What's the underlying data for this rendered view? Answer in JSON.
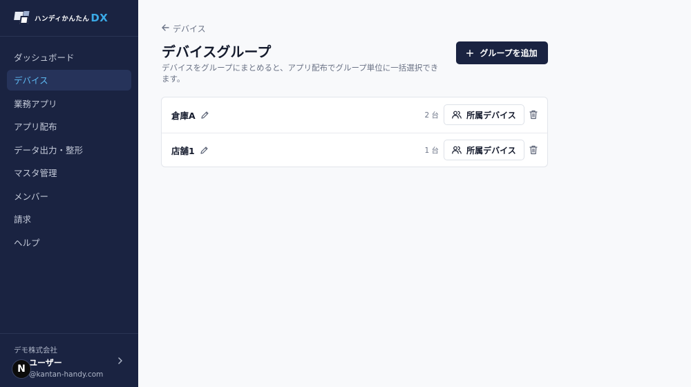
{
  "brand": {
    "name": "ハンディかんたん",
    "suffix": "DX"
  },
  "sidebar": {
    "items": [
      {
        "label": "ダッシュボード",
        "active": false
      },
      {
        "label": "デバイス",
        "active": true
      },
      {
        "label": "業務アプリ",
        "active": false
      },
      {
        "label": "アプリ配布",
        "active": false
      },
      {
        "label": "データ出力・整形",
        "active": false
      },
      {
        "label": "マスタ管理",
        "active": false
      },
      {
        "label": "メンバー",
        "active": false
      },
      {
        "label": "請求",
        "active": false
      },
      {
        "label": "ヘルプ",
        "active": false
      }
    ],
    "user": {
      "company": "デモ株式会社",
      "name": "ユーザー",
      "email": "@kantan-handy.com",
      "avatar": "N"
    }
  },
  "main": {
    "breadcrumb": "デバイス",
    "title": "デバイスグループ",
    "description": "デバイスをグループにまとめると、アプリ配布でグループ単位に一括選択できます。",
    "add_button": "グループを追加",
    "groups": [
      {
        "name": "倉庫A",
        "count": "2 台",
        "members_label": "所属デバイス"
      },
      {
        "name": "店舗1",
        "count": "1 台",
        "members_label": "所属デバイス"
      }
    ]
  },
  "colors": {
    "sidebar_bg": "#1a2341",
    "accent": "#5db7f0",
    "primary_button": "#1a2341"
  }
}
